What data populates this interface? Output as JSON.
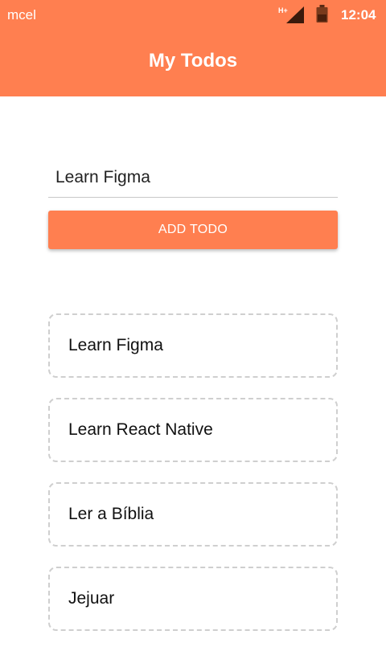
{
  "status_bar": {
    "carrier": "mcel",
    "network_type": "H+",
    "time": "12:04",
    "signal_icon": "signal-icon",
    "battery_icon": "battery-icon"
  },
  "header": {
    "title": "My Todos",
    "color": "#ff7f50"
  },
  "form": {
    "input_value": "Learn Figma",
    "add_button_label": "ADD TODO"
  },
  "todos": [
    {
      "text": "Learn Figma"
    },
    {
      "text": "Learn React Native"
    },
    {
      "text": "Ler a Bíblia"
    },
    {
      "text": "Jejuar"
    }
  ]
}
